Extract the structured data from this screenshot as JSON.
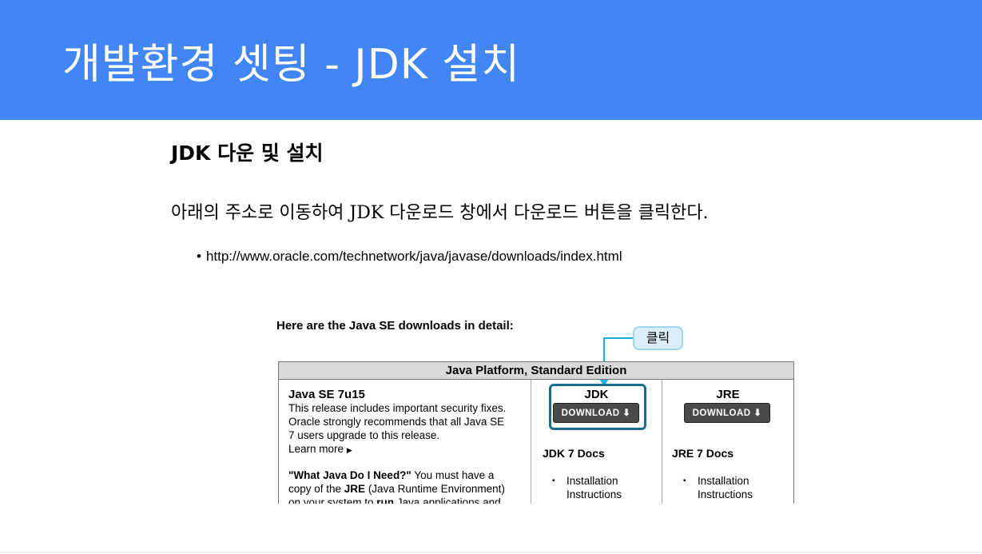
{
  "slide": {
    "title": "개발환경 셋팅 - JDK 설치",
    "section_title": "JDK 다운 및 설치",
    "body_text": "아래의 주소로 이동하여 JDK 다운로드 창에서 다운로드 버튼을 클릭한다.",
    "bullet_symbol": "•",
    "bullet_url": "http://www.oracle.com/technetwork/java/javase/downloads/index.html",
    "header_color": "#4285f4"
  },
  "screenshot": {
    "heading": "Here are the Java SE downloads in detail:",
    "callout_label": "클릭",
    "table_header": "Java Platform, Standard Edition",
    "release": {
      "title": "Java SE 7u15",
      "text_lines": [
        "This release includes important security fixes.",
        "Oracle strongly recommends that all Java SE",
        "7 users upgrade to this release."
      ],
      "learn_more": "Learn more",
      "learn_more_icon": "triangle-right-icon",
      "what_java_bold": "\"What Java Do I Need?\"",
      "what_java_rest": " You must have a",
      "what_java_line2_pre": "copy of the ",
      "what_java_line2_bold": "JRE",
      "what_java_line2_post": " (Java Runtime Environment)",
      "what_java_line3_pre": "on your system to ",
      "what_java_line3_bold": "run",
      "what_java_line3_post": " Java applications and"
    },
    "jdk": {
      "label": "JDK",
      "button": "DOWNLOAD ⬇",
      "docs_title": "JDK 7 Docs",
      "doc_items": [
        "Installation",
        "Instructions"
      ]
    },
    "jre": {
      "label": "JRE",
      "button": "DOWNLOAD ⬇",
      "docs_title": "JRE 7 Docs",
      "doc_items": [
        "Installation",
        "Instructions"
      ]
    },
    "highlight_color": "#1b6d8e",
    "callout_color": "#1ab0e4"
  }
}
